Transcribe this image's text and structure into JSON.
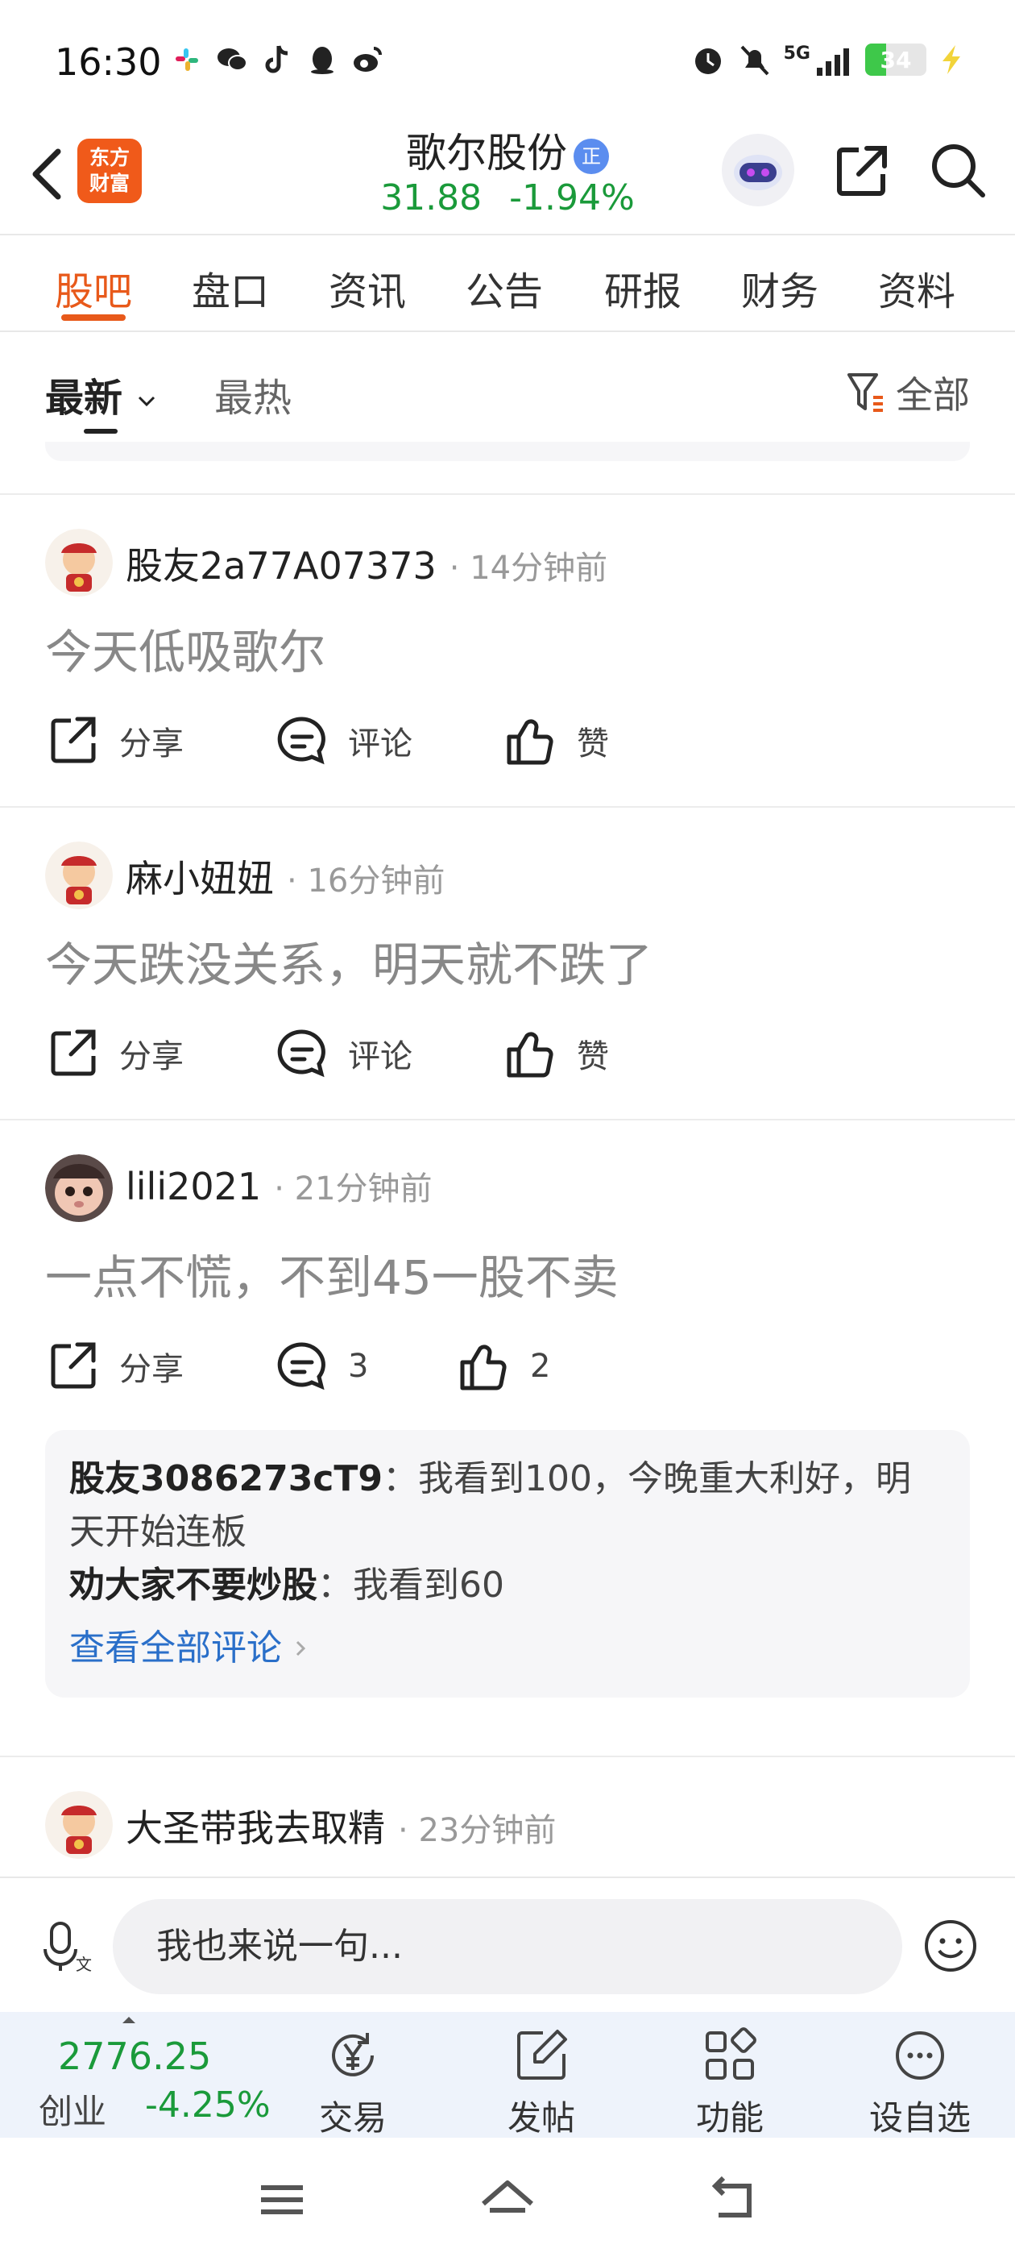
{
  "status": {
    "time": "16:30",
    "network": "5G",
    "battery": "34"
  },
  "header": {
    "logo_line1": "东方",
    "logo_line2": "财富",
    "stock_name": "歌尔股份",
    "badge": "正",
    "price": "31.88",
    "change": "-1.94%"
  },
  "tabs": [
    "股吧",
    "盘口",
    "资讯",
    "公告",
    "研报",
    "财务",
    "资料"
  ],
  "subtabs": {
    "latest": "最新",
    "hot": "最热",
    "filter": "全部"
  },
  "posts": [
    {
      "author": "股友2a77A07373",
      "time": "14分钟前",
      "content": "今天低吸歌尔",
      "share": "分享",
      "comment": "评论",
      "like": "赞"
    },
    {
      "author": "麻小妞妞",
      "time": "16分钟前",
      "content": "今天跌没关系，明天就不跌了",
      "share": "分享",
      "comment": "评论",
      "like": "赞"
    },
    {
      "author": "lili2021",
      "time": "21分钟前",
      "content": "一点不慌，不到45一股不卖",
      "share": "分享",
      "comment": "3",
      "like": "2",
      "comments": [
        {
          "user": "股友3086273cT9",
          "text": "：我看到100，今晚重大利好，明天开始连板"
        },
        {
          "user": "劝大家不要炒股",
          "text": "：我看到60"
        }
      ],
      "view_all": "查看全部评论"
    },
    {
      "author": "大圣带我去取精",
      "time": "23分钟前"
    }
  ],
  "composer": {
    "placeholder": "我也来说一句..."
  },
  "bottom": {
    "index_value": "2776.25",
    "index_name": "创业",
    "index_change": "-4.25%",
    "trade": "交易",
    "post": "发帖",
    "function": "功能",
    "watchlist": "设自选"
  },
  "colors": {
    "accent": "#e8591a",
    "down_green": "#1a9a3a",
    "link_blue": "#2a6fc9"
  }
}
